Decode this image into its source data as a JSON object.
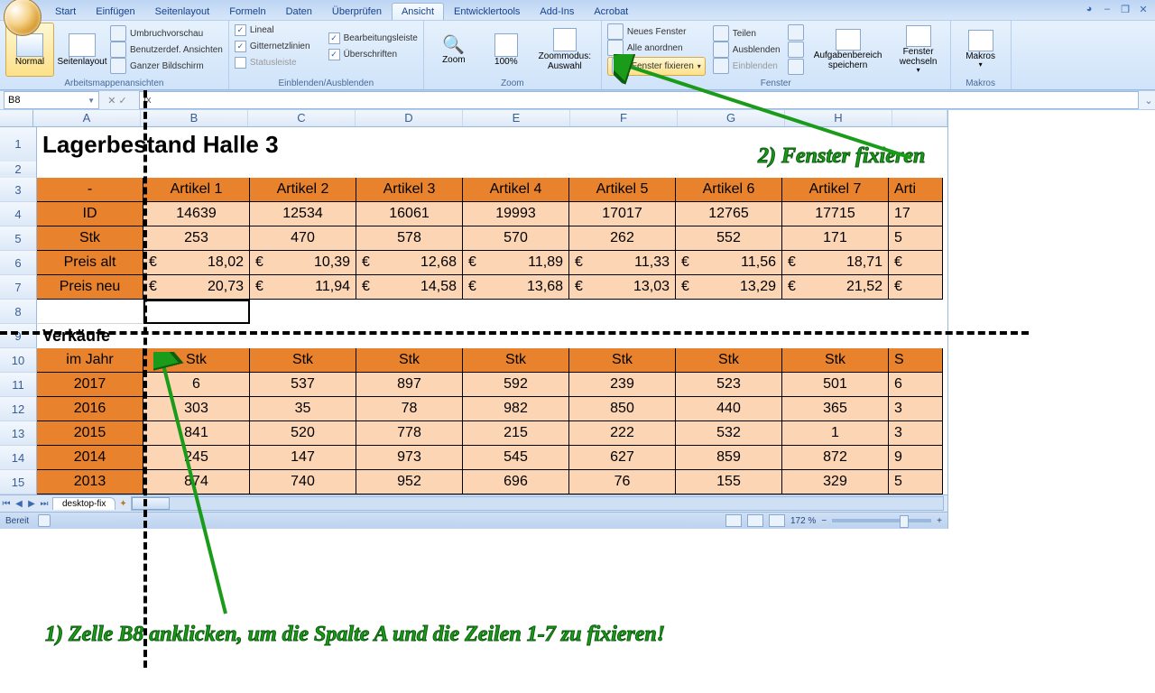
{
  "tabs": [
    "Start",
    "Einfügen",
    "Seitenlayout",
    "Formeln",
    "Daten",
    "Überprüfen",
    "Ansicht",
    "Entwicklertools",
    "Add-Ins",
    "Acrobat"
  ],
  "activeTab": "Ansicht",
  "ribbon": {
    "views": {
      "normal": "Normal",
      "layout": "Seitenlayout",
      "umbruch": "Umbruchvorschau",
      "benutzer": "Benutzerdef. Ansichten",
      "ganzer": "Ganzer Bildschirm",
      "group": "Arbeitsmappenansichten"
    },
    "show": {
      "lineal": "Lineal",
      "gitter": "Gitternetzlinien",
      "status": "Statusleiste",
      "bearb": "Bearbeitungsleiste",
      "ueber": "Überschriften",
      "group": "Einblenden/Ausblenden"
    },
    "zoom": {
      "zoom": "Zoom",
      "hundred": "100%",
      "sel": "Zoommodus: Auswahl",
      "group": "Zoom"
    },
    "window": {
      "neues": "Neues Fenster",
      "alle": "Alle anordnen",
      "fix": "Fenster fixieren",
      "teilen": "Teilen",
      "aus": "Ausblenden",
      "ein": "Einblenden",
      "save": "Aufgabenbereich speichern",
      "wechsel": "Fenster wechseln",
      "group": "Fenster"
    },
    "macros": {
      "label": "Makros",
      "group": "Makros"
    }
  },
  "namebox": "B8",
  "fx": "fx",
  "cols": [
    "A",
    "B",
    "C",
    "D",
    "E",
    "F",
    "G",
    "H"
  ],
  "title": "Lagerbestand Halle 3",
  "row3": [
    "-",
    "Artikel 1",
    "Artikel 2",
    "Artikel 3",
    "Artikel 4",
    "Artikel 5",
    "Artikel 6",
    "Artikel 7",
    "Arti"
  ],
  "row4": [
    "ID",
    "14639",
    "12534",
    "16061",
    "19993",
    "17017",
    "12765",
    "17715",
    "17"
  ],
  "row5": [
    "Stk",
    "253",
    "470",
    "578",
    "570",
    "262",
    "552",
    "171",
    "5"
  ],
  "row6": [
    "Preis alt",
    "18,02",
    "10,39",
    "12,68",
    "11,89",
    "11,33",
    "11,56",
    "18,71",
    ""
  ],
  "row7": [
    "Preis neu",
    "20,73",
    "11,94",
    "14,58",
    "13,68",
    "13,03",
    "13,29",
    "21,52",
    ""
  ],
  "row9": "Verkäufe",
  "row10": [
    "im Jahr",
    "Stk",
    "Stk",
    "Stk",
    "Stk",
    "Stk",
    "Stk",
    "Stk",
    "S"
  ],
  "row11": [
    "2017",
    "6",
    "537",
    "897",
    "592",
    "239",
    "523",
    "501",
    "6"
  ],
  "row12": [
    "2016",
    "303",
    "35",
    "78",
    "982",
    "850",
    "440",
    "365",
    "3"
  ],
  "row13": [
    "2015",
    "841",
    "520",
    "778",
    "215",
    "222",
    "532",
    "1",
    "3"
  ],
  "row14": [
    "2014",
    "245",
    "147",
    "973",
    "545",
    "627",
    "859",
    "872",
    "9"
  ],
  "row15": [
    "2013",
    "874",
    "740",
    "952",
    "696",
    "76",
    "155",
    "329",
    "5"
  ],
  "euro": "€",
  "sheetTab": "desktop-fix",
  "status": {
    "ready": "Bereit",
    "zoom": "172 %"
  },
  "annot1": "1) Zelle B8 anklicken, um die Spalte A und die Zeilen 1-7 zu fixieren!",
  "annot2": "2) Fenster fixieren"
}
